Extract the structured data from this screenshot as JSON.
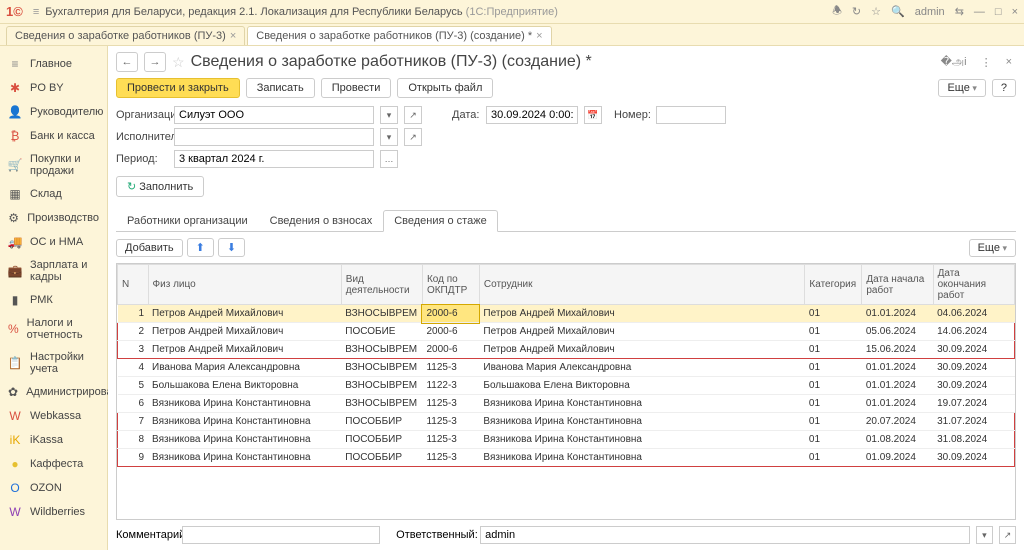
{
  "app": {
    "title": "Бухгалтерия для Беларуси, редакция 2.1. Локализация для Республики Беларусь",
    "subtitle": "(1С:Предприятие)",
    "user": "admin"
  },
  "doc_tabs": [
    {
      "label": "Сведения о заработке работников (ПУ-3)",
      "active": false
    },
    {
      "label": "Сведения о заработке работников (ПУ-3) (создание) *",
      "active": true
    }
  ],
  "nav": [
    {
      "icon": "≡",
      "label": "Главное",
      "color": "#888"
    },
    {
      "icon": "✱",
      "label": "PO BY",
      "color": "#d94f3f"
    },
    {
      "icon": "👤",
      "label": "Руководителю",
      "color": "#d94f3f"
    },
    {
      "icon": "₿",
      "label": "Банк и касса",
      "color": "#d94f3f"
    },
    {
      "icon": "🛒",
      "label": "Покупки и продажи",
      "color": "#555"
    },
    {
      "icon": "▦",
      "label": "Склад",
      "color": "#555"
    },
    {
      "icon": "⚙",
      "label": "Производство",
      "color": "#555"
    },
    {
      "icon": "🚚",
      "label": "ОС и НМА",
      "color": "#555"
    },
    {
      "icon": "💼",
      "label": "Зарплата и кадры",
      "color": "#555"
    },
    {
      "icon": "▮",
      "label": "РМК",
      "color": "#555"
    },
    {
      "icon": "%",
      "label": "Налоги и отчетность",
      "color": "#d94f3f"
    },
    {
      "icon": "📋",
      "label": "Настройки учета",
      "color": "#555"
    },
    {
      "icon": "✿",
      "label": "Администрирование",
      "color": "#555"
    },
    {
      "icon": "W",
      "label": "Webkassa",
      "color": "#d94f3f"
    },
    {
      "icon": "iK",
      "label": "iKassa",
      "color": "#e6a800"
    },
    {
      "icon": "●",
      "label": "Каффеста",
      "color": "#e6c030"
    },
    {
      "icon": "O",
      "label": "OZON",
      "color": "#1e6fd9"
    },
    {
      "icon": "W",
      "label": "Wildberries",
      "color": "#8e3fb5"
    }
  ],
  "page": {
    "title": "Сведения о заработке работников (ПУ-3) (создание) *",
    "btn_post_close": "Провести и закрыть",
    "btn_write": "Записать",
    "btn_post": "Провести",
    "btn_open_file": "Открыть файл",
    "btn_more": "Еще",
    "btn_help": "?",
    "lbl_org": "Организация:",
    "org_value": "Силуэт ООО",
    "lbl_date": "Дата:",
    "date_value": "30.09.2024 0:00:0",
    "lbl_num": "Номер:",
    "num_value": "",
    "lbl_exec": "Исполнитель:",
    "exec_value": "",
    "lbl_period": "Период:",
    "period_value": "3 квартал 2024 г.",
    "btn_fill": "Заполнить",
    "subtabs": [
      "Работники организации",
      "Сведения о взносах",
      "Сведения о стаже"
    ],
    "btn_add": "Добавить",
    "lbl_comment": "Комментарий:",
    "comment_value": "",
    "lbl_resp": "Ответственный:",
    "resp_value": "admin"
  },
  "table": {
    "headers": [
      "N",
      "Физ лицо",
      "Вид деятельности",
      "Код по ОКПДТР",
      "Сотрудник",
      "Категория",
      "Дата начала работ",
      "Дата окончания работ"
    ],
    "rows": [
      {
        "n": "1",
        "fiz": "Петров Андрей Михайлович",
        "vid": "ВЗНОСЫВРЕМ",
        "kod": "2000-6",
        "sotr": "Петров Андрей Михайлович",
        "kat": "01",
        "d1": "01.01.2024",
        "d2": "04.06.2024"
      },
      {
        "n": "2",
        "fiz": "Петров Андрей Михайлович",
        "vid": "ПОСОБИЕ",
        "kod": "2000-6",
        "sotr": "Петров Андрей Михайлович",
        "kat": "01",
        "d1": "05.06.2024",
        "d2": "14.06.2024"
      },
      {
        "n": "3",
        "fiz": "Петров Андрей Михайлович",
        "vid": "ВЗНОСЫВРЕМ",
        "kod": "2000-6",
        "sotr": "Петров Андрей Михайлович",
        "kat": "01",
        "d1": "15.06.2024",
        "d2": "30.09.2024"
      },
      {
        "n": "4",
        "fiz": "Иванова Мария Александровна",
        "vid": "ВЗНОСЫВРЕМ",
        "kod": "1125-3",
        "sotr": "Иванова Мария Александровна",
        "kat": "01",
        "d1": "01.01.2024",
        "d2": "30.09.2024"
      },
      {
        "n": "5",
        "fiz": "Большакова Елена Викторовна",
        "vid": "ВЗНОСЫВРЕМ",
        "kod": "1122-3",
        "sotr": "Большакова Елена Викторовна",
        "kat": "01",
        "d1": "01.01.2024",
        "d2": "30.09.2024"
      },
      {
        "n": "6",
        "fiz": "Вязникова Ирина Константиновна",
        "vid": "ВЗНОСЫВРЕМ",
        "kod": "1125-3",
        "sotr": "Вязникова Ирина Константиновна",
        "kat": "01",
        "d1": "01.01.2024",
        "d2": "19.07.2024"
      },
      {
        "n": "7",
        "fiz": "Вязникова Ирина Константиновна",
        "vid": "ПОСОББИР",
        "kod": "1125-3",
        "sotr": "Вязникова Ирина Константиновна",
        "kat": "01",
        "d1": "20.07.2024",
        "d2": "31.07.2024"
      },
      {
        "n": "8",
        "fiz": "Вязникова Ирина Константиновна",
        "vid": "ПОСОББИР",
        "kod": "1125-3",
        "sotr": "Вязникова Ирина Константиновна",
        "kat": "01",
        "d1": "01.08.2024",
        "d2": "31.08.2024"
      },
      {
        "n": "9",
        "fiz": "Вязникова Ирина Константиновна",
        "vid": "ПОСОББИР",
        "kod": "1125-3",
        "sotr": "Вязникова Ирина Константиновна",
        "kat": "01",
        "d1": "01.09.2024",
        "d2": "30.09.2024"
      }
    ]
  }
}
